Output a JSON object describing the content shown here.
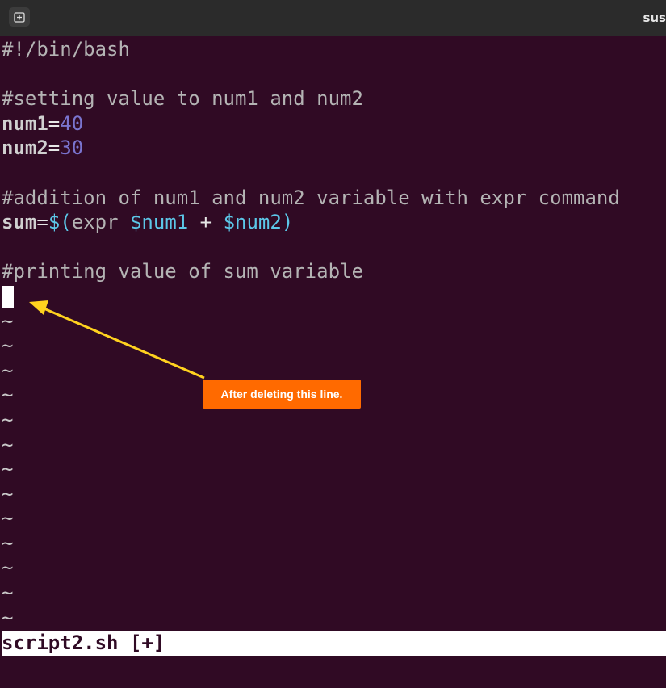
{
  "window": {
    "title": "sus"
  },
  "editor": {
    "shebang": "#!/bin/bash",
    "comment1": "#setting value to num1 and num2",
    "assign1": {
      "name": "num1",
      "eq": "=",
      "value": "40"
    },
    "assign2": {
      "name": "num2",
      "eq": "=",
      "value": "30"
    },
    "comment2": "#addition of num1 and num2 variable with expr command",
    "sum_line": {
      "name": "sum",
      "eq": "=",
      "open": "$(",
      "cmd": "expr",
      "var1": "$num1",
      "plus": "+",
      "var2": "$num2",
      "close": ")"
    },
    "comment3": "#printing value of sum variable",
    "tilde": "~"
  },
  "statusbar": {
    "filename": "script2.sh [+]"
  },
  "annotation": {
    "label": "After deleting this line."
  },
  "colors": {
    "background": "#300a24",
    "number": "#7a74cf",
    "variable": "#5cc7e8",
    "callout": "#ff6a00",
    "arrow": "#ffd21f"
  }
}
